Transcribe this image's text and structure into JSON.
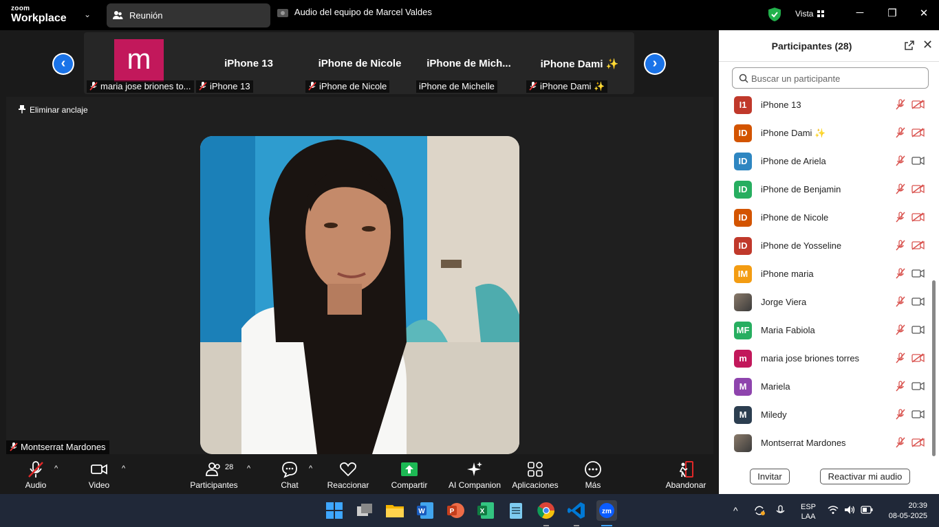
{
  "titlebar": {
    "logo_line1": "zoom",
    "logo_line2": "Workplace",
    "meeting_tab": "Reunión",
    "audio_tab": "Audio del equipo de Marcel Valdes",
    "view_label": "Vista",
    "minimize": "─",
    "restore": "❐",
    "close": "✕"
  },
  "strip": {
    "thumbs": [
      {
        "avatar_letter": "m",
        "label": "maria jose briones to..."
      },
      {
        "name": "iPhone 13",
        "label": "iPhone 13"
      },
      {
        "name": "iPhone de Nicole",
        "label": "iPhone de Nicole"
      },
      {
        "name": "iPhone  de  Mich...",
        "label": "iPhone de Michelle"
      },
      {
        "name": "iPhone  Dami ✨",
        "label": "iPhone Dami ✨"
      }
    ],
    "prev": "‹",
    "next": "›"
  },
  "main": {
    "unpin_label": "Eliminar anclaje",
    "speaker_name": "Montserrat Mardones"
  },
  "panel": {
    "title": "Participantes (28)",
    "close": "✕",
    "search_placeholder": "Buscar un participante",
    "participants": [
      {
        "initials": "I1",
        "name": "iPhone 13",
        "color": "#c0392b",
        "video_off": true
      },
      {
        "initials": "ID",
        "name": "iPhone Dami ✨",
        "color": "#d35400",
        "video_off": true
      },
      {
        "initials": "ID",
        "name": "iPhone de Ariela",
        "color": "#2e86c1",
        "video_off": false
      },
      {
        "initials": "ID",
        "name": "iPhone de Benjamin",
        "color": "#27ae60",
        "video_off": true
      },
      {
        "initials": "ID",
        "name": "iPhone de Nicole",
        "color": "#d35400",
        "video_off": true
      },
      {
        "initials": "ID",
        "name": "iPhone de Yosseline",
        "color": "#c0392b",
        "video_off": true
      },
      {
        "initials": "IM",
        "name": "iPhone maria",
        "color": "#f39c12",
        "video_off": false
      },
      {
        "initials": "",
        "name": "Jorge Viera",
        "color": "#556070",
        "video_off": false
      },
      {
        "initials": "MF",
        "name": "Maria Fabiola",
        "color": "#27ae60",
        "video_off": false
      },
      {
        "initials": "m",
        "name": "maria jose briones torres",
        "color": "#c2185b",
        "video_off": true
      },
      {
        "initials": "M",
        "name": "Mariela",
        "color": "#8e44ad",
        "video_off": false
      },
      {
        "initials": "M",
        "name": "Miledy",
        "color": "#2c3e50",
        "video_off": false
      },
      {
        "initials": "",
        "name": "Montserrat Mardones",
        "color": "#7a5a4a",
        "video_off": true
      }
    ],
    "invite_label": "Invitar",
    "unmute_label": "Reactivar mi audio"
  },
  "toolbar": {
    "audio": "Audio",
    "video": "Video",
    "participants": "Participantes",
    "participants_count": "28",
    "chat": "Chat",
    "react": "Reaccionar",
    "share": "Compartir",
    "ai": "AI Companion",
    "apps": "Aplicaciones",
    "more": "Más",
    "leave": "Abandonar",
    "accent_share": "#1db954",
    "accent_leave": "#e02828"
  },
  "taskbar": {
    "lang1": "ESP",
    "lang2": "LAA",
    "time": "20:39",
    "date": "08-05-2025"
  }
}
